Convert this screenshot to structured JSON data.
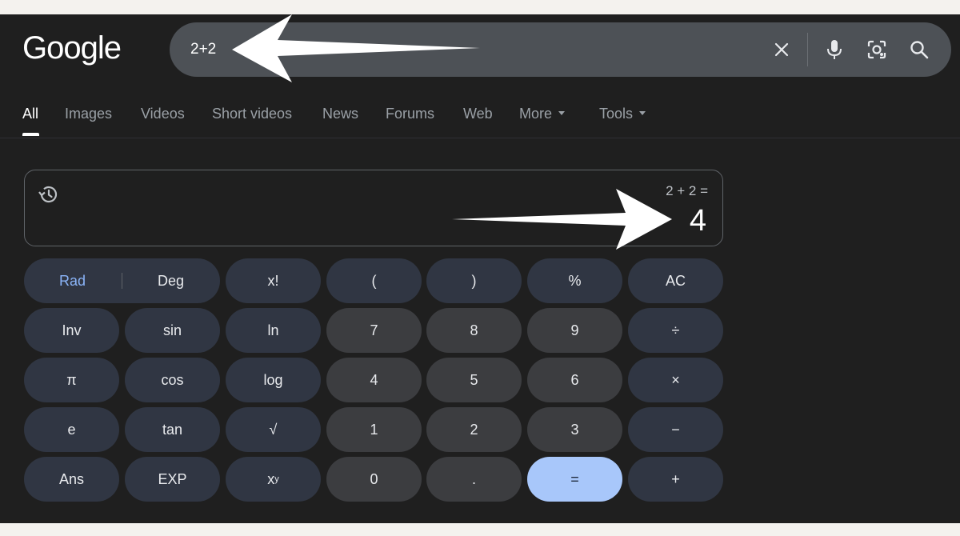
{
  "logo": "Google",
  "search": {
    "query": "2+2",
    "icons": [
      "close-icon",
      "microphone-icon",
      "lens-icon",
      "search-icon"
    ]
  },
  "tabs": [
    {
      "label": "All",
      "active": true
    },
    {
      "label": "Images"
    },
    {
      "label": "Videos"
    },
    {
      "label": "Short videos"
    },
    {
      "label": "News"
    },
    {
      "label": "Forums"
    },
    {
      "label": "Web"
    },
    {
      "label": "More",
      "dropdown": true
    },
    {
      "label": "Tools",
      "dropdown": true
    }
  ],
  "calculator": {
    "expression": "2 + 2 =",
    "result": "4",
    "buttons": {
      "rad": "Rad",
      "deg": "Deg",
      "factorial": "x!",
      "open_paren": "(",
      "close_paren": ")",
      "percent": "%",
      "clear": "AC",
      "inv": "Inv",
      "sin": "sin",
      "ln": "ln",
      "seven": "7",
      "eight": "8",
      "nine": "9",
      "divide": "÷",
      "pi": "π",
      "cos": "cos",
      "log": "log",
      "four": "4",
      "five": "5",
      "six": "6",
      "multiply": "×",
      "e": "e",
      "tan": "tan",
      "sqrt": "√",
      "one": "1",
      "two": "2",
      "three": "3",
      "minus": "−",
      "ans": "Ans",
      "exp": "EXP",
      "power_base": "x",
      "power_exp": "y",
      "zero": "0",
      "decimal": ".",
      "equals": "=",
      "plus": "+"
    }
  },
  "colors": {
    "background": "#1f1f1f",
    "search_bar": "#4d5156",
    "function_key": "#303643",
    "number_key": "#3c3d40",
    "equals_key": "#a8c7fa",
    "rad_accent": "#8ab4f8"
  }
}
